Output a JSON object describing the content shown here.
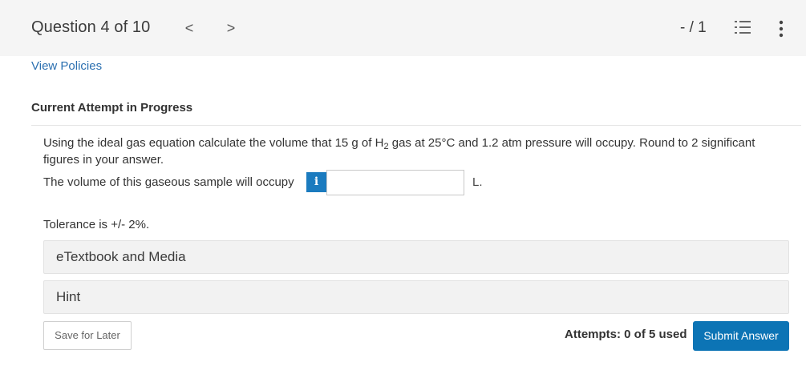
{
  "header": {
    "question_title": "Question 4 of 10",
    "prev_glyph": "<",
    "next_glyph": ">",
    "score": "- / 1",
    "list_icon": "numbered-list-icon",
    "more_icon": "more-vertical-icon"
  },
  "links": {
    "view_policies": "View Policies"
  },
  "attempt": {
    "heading": "Current Attempt in Progress"
  },
  "question": {
    "text_before": "Using the ideal gas equation calculate the volume that 15 g of H",
    "subscript": "2",
    "text_after": " gas at 25°C and 1.2 atm pressure will occupy. Round to 2 significant figures in your answer.",
    "answer_label": "The volume of this gaseous sample will occupy",
    "info_glyph": "i",
    "answer_value": "",
    "unit": "L.",
    "tolerance": "Tolerance is +/- 2%."
  },
  "panels": {
    "ebook": "eTextbook and Media",
    "hint": "Hint"
  },
  "footer": {
    "save_label": "Save for Later",
    "attempts_text": "Attempts: 0 of 5 used",
    "submit_label": "Submit Answer"
  },
  "colors": {
    "accent": "#0c74b5",
    "link": "#2a6fb0",
    "info": "#1b7bbf"
  }
}
